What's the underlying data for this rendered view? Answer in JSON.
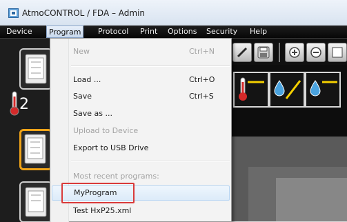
{
  "window": {
    "title": "AtmoCONTROL / FDA – Admin"
  },
  "menubar": [
    "Device",
    "Program",
    "Protocol",
    "Print",
    "Options",
    "Security",
    "Help"
  ],
  "program_menu": {
    "new": {
      "label": "New",
      "shortcut": "Ctrl+N"
    },
    "load": {
      "label": "Load ...",
      "shortcut": "Ctrl+O"
    },
    "save": {
      "label": "Save",
      "shortcut": "Ctrl+S"
    },
    "save_as": {
      "label": "Save as ..."
    },
    "upload": {
      "label": "Upload to Device"
    },
    "export": {
      "label": "Export to USB Drive"
    },
    "recent_heading": "Most recent programs:",
    "recent": [
      "MyProgram",
      "Test HxP25.xml"
    ]
  },
  "device_panel": {
    "value": "2"
  },
  "colors": {
    "accent_orange": "#f0a418",
    "highlight_red": "#d93a3a",
    "symbol_yellow": "#f5d000",
    "symbol_blue": "#4aa3df"
  }
}
